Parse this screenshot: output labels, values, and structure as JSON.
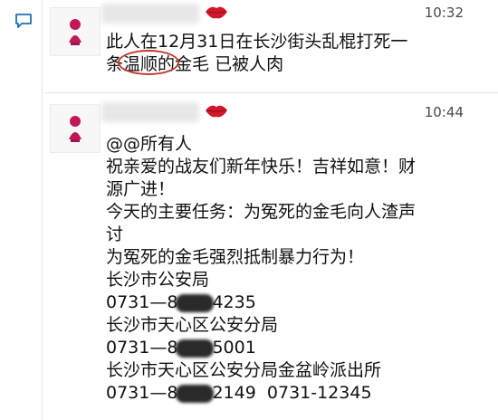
{
  "messages": [
    {
      "time": "10:32",
      "text_a": "此人在12月31日在长沙街头乱棍打死一",
      "text_b1": "条",
      "text_b_circled": "温顺的",
      "text_b2": "金毛  已被人肉"
    },
    {
      "time": "10:44",
      "lines": [
        "@@所有人",
        "祝亲爱的战友们新年快乐！吉祥如意！财",
        "源广进！",
        "今天的主要任务：为冤死的金毛向人渣声",
        "讨",
        "为冤死的金毛强烈抵制暴力行为！",
        "长沙市公安局"
      ],
      "phone1_prefix": "0731—8",
      "phone1_suffix": "4235",
      "station2": "长沙市天心区公安分局",
      "phone2_prefix": "0731—8",
      "phone2_suffix": "5001",
      "station3": "长沙市天心区公安分局金盆岭派出所",
      "phone3_prefix": "0731—8",
      "phone3_suffix": "2149  0731-12345"
    }
  ],
  "colors": {
    "circle": "#c0392b",
    "lips": "#d0182a",
    "redaction": "#2a2a2a"
  },
  "icons": [
    "chat-bubble-icon",
    "avatar-doll-icon",
    "lips-icon"
  ]
}
